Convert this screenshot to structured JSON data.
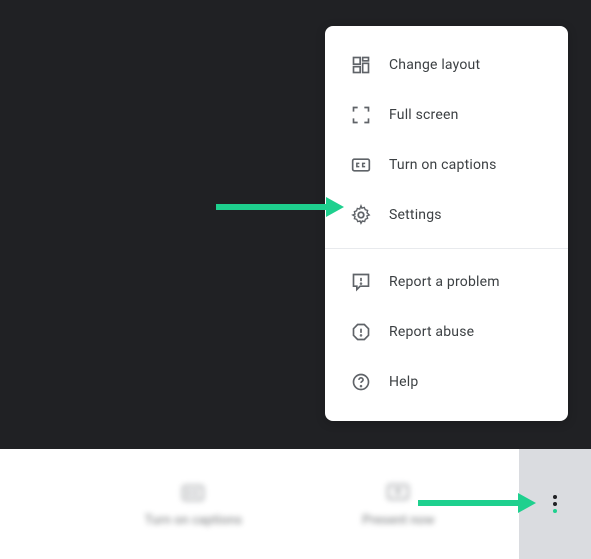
{
  "menu": {
    "items": [
      {
        "label": "Change layout",
        "icon": "layout-icon"
      },
      {
        "label": "Full screen",
        "icon": "fullscreen-icon"
      },
      {
        "label": "Turn on captions",
        "icon": "cc-icon"
      },
      {
        "label": "Settings",
        "icon": "gear-icon"
      }
    ],
    "items2": [
      {
        "label": "Report a problem",
        "icon": "feedback-icon"
      },
      {
        "label": "Report abuse",
        "icon": "report-abuse-icon"
      },
      {
        "label": "Help",
        "icon": "help-icon"
      }
    ]
  },
  "bottom": {
    "captions_label": "Turn on captions",
    "present_label": "Present now"
  },
  "colors": {
    "arrow": "#1ed08e",
    "menu_text": "#3c4043",
    "icon": "#5f6368"
  }
}
